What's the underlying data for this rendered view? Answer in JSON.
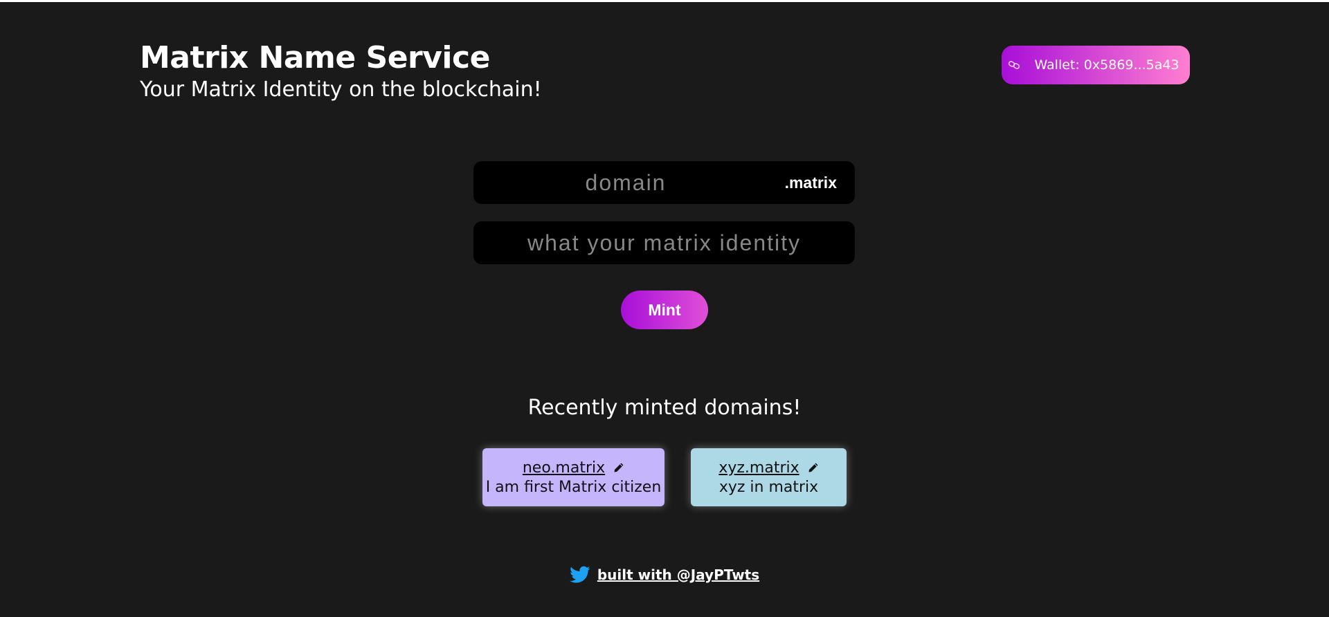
{
  "header": {
    "title": "Matrix Name Service",
    "subtitle": "Your Matrix Identity on the blockchain!"
  },
  "wallet": {
    "label": "Wallet: 0x5869...5a43",
    "icon": "link-icon"
  },
  "form": {
    "domain_placeholder": "domain",
    "domain_value": "",
    "tld": ".matrix",
    "record_placeholder": "what your matrix identity",
    "record_value": "",
    "mint_label": "Mint"
  },
  "recent": {
    "title": "Recently minted domains!",
    "items": [
      {
        "name": "neo.matrix",
        "record": "I am first Matrix citizen",
        "color": "#c4b5fd"
      },
      {
        "name": "xyz.matrix",
        "record": "xyz in matrix",
        "color": "#add8e6"
      }
    ]
  },
  "footer": {
    "link_text": "built with @JayPTwts",
    "icon": "twitter-icon"
  },
  "colors": {
    "background": "#1a1a1a",
    "accent_start": "#a80fd8",
    "accent_end": "#ff7fd1"
  }
}
